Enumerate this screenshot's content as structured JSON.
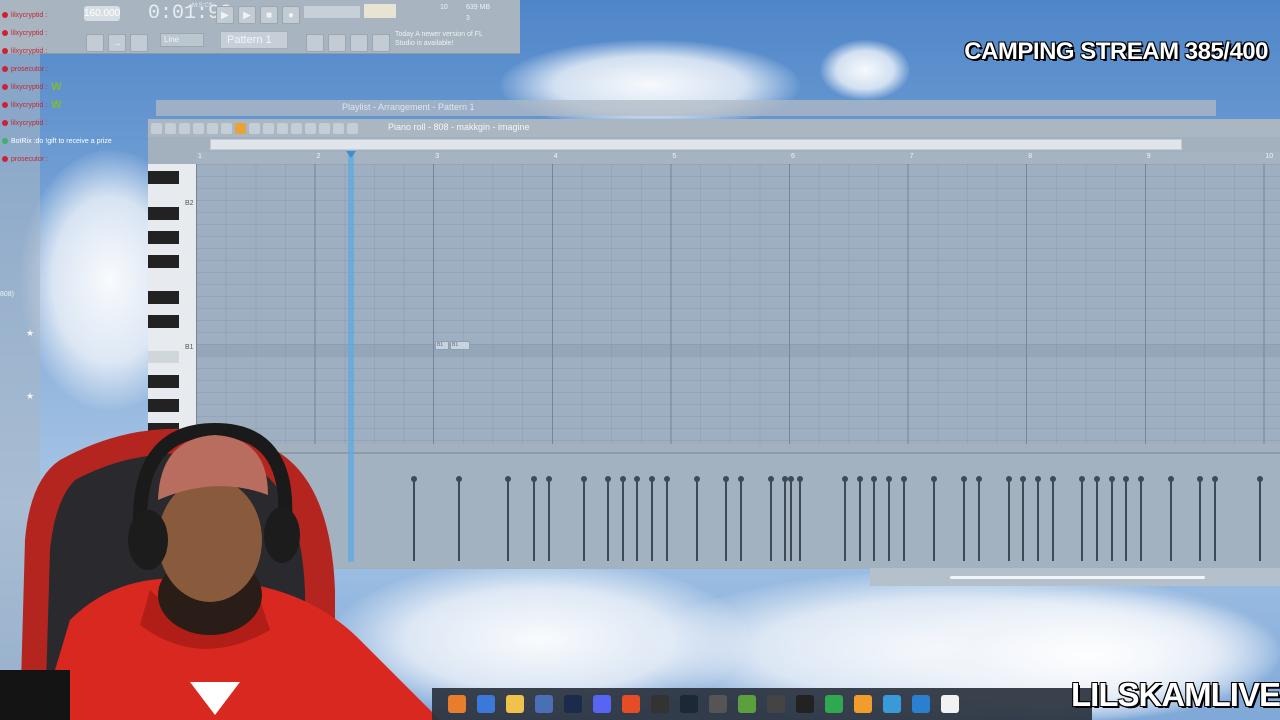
{
  "toolbar": {
    "tempo": "160.000",
    "time": "0:01:98",
    "time_sub": "M:S:CS",
    "cpu": "10",
    "memory": "639 MB",
    "voices": "3",
    "snap": "Line",
    "pattern": "Pattern 1",
    "news": "Today A newer version of FL Studio is available!"
  },
  "chat": {
    "messages": [
      {
        "user": "lilxycryptid",
        "text": ""
      },
      {
        "user": "lilxycryptid",
        "text": ""
      },
      {
        "user": "lilxycryptid",
        "text": ""
      },
      {
        "user": "prosecutor",
        "text": ""
      },
      {
        "user": "lilxycryptid",
        "text": "W"
      },
      {
        "user": "lilxycryptid",
        "text": "W"
      },
      {
        "user": "lilxycryptid",
        "text": ""
      },
      {
        "user": "BotRix",
        "text": "do !gift to receive a prize"
      },
      {
        "user": "prosecutor",
        "text": ""
      }
    ],
    "side_text": "808)"
  },
  "playlist": {
    "title": "Playlist - Arrangement - Pattern 1"
  },
  "piano_roll": {
    "title": "Piano roll - 808 - makkgin - imagine",
    "bars": [
      "1",
      "2",
      "3",
      "4",
      "5",
      "6",
      "7",
      "8",
      "9",
      "10"
    ],
    "key_labels": [
      "B2",
      "B1"
    ],
    "notes": [
      "B1",
      "B1"
    ]
  },
  "overlay": {
    "stream_title": "CAMPING STREAM 385/400",
    "channel": "LILSKAMLIVE"
  }
}
